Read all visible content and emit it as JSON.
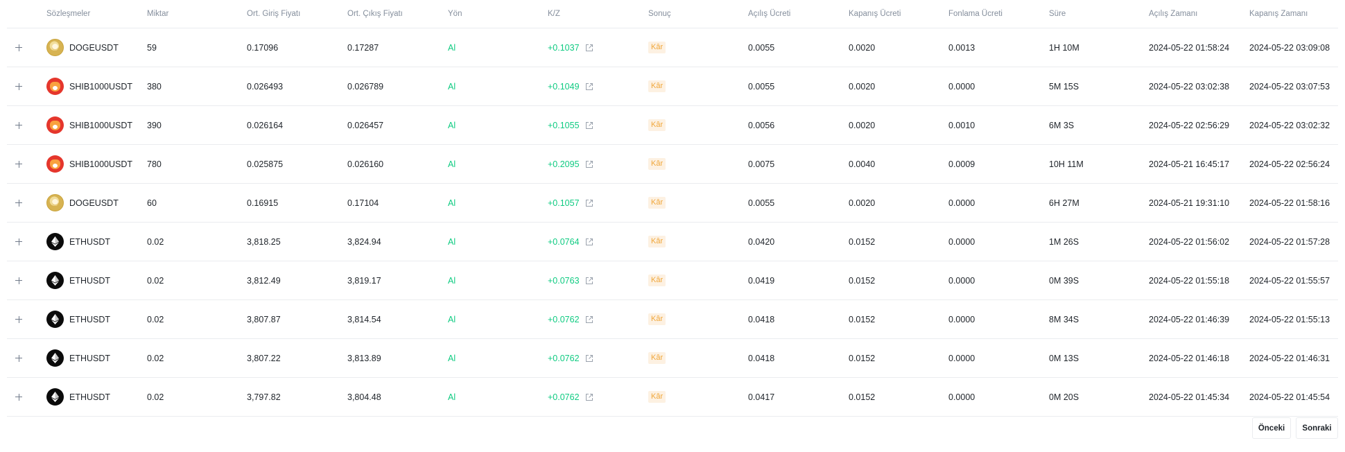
{
  "table": {
    "columns": {
      "contract": "Sözleşmeler",
      "qty": "Miktar",
      "entry": "Ort. Giriş Fiyatı",
      "exit": "Ort. Çıkış Fiyatı",
      "side": "Yön",
      "pnl": "K/Z",
      "result": "Sonuç",
      "openfee": "Açılış Ücreti",
      "closefee": "Kapanış Ücreti",
      "fundfee": "Fonlama Ücreti",
      "duration": "Süre",
      "opentime": "Açılış Zamanı",
      "closetime": "Kapanış Zamanı"
    },
    "rows": [
      {
        "icon": "doge-coin-icon",
        "contract": "DOGEUSDT",
        "qty": "59",
        "entry": "0.17096",
        "exit": "0.17287",
        "side": "Al",
        "pnl": "+0.1037",
        "result": "Kâr",
        "openfee": "0.0055",
        "closefee": "0.0020",
        "fundfee": "0.0013",
        "duration": "1H 10M",
        "opentime": "2024-05-22 01:58:24",
        "closetime": "2024-05-22 03:09:08"
      },
      {
        "icon": "shib-coin-icon",
        "contract": "SHIB1000USDT",
        "qty": "380",
        "entry": "0.026493",
        "exit": "0.026789",
        "side": "Al",
        "pnl": "+0.1049",
        "result": "Kâr",
        "openfee": "0.0055",
        "closefee": "0.0020",
        "fundfee": "0.0000",
        "duration": "5M 15S",
        "opentime": "2024-05-22 03:02:38",
        "closetime": "2024-05-22 03:07:53"
      },
      {
        "icon": "shib-coin-icon",
        "contract": "SHIB1000USDT",
        "qty": "390",
        "entry": "0.026164",
        "exit": "0.026457",
        "side": "Al",
        "pnl": "+0.1055",
        "result": "Kâr",
        "openfee": "0.0056",
        "closefee": "0.0020",
        "fundfee": "0.0010",
        "duration": "6M 3S",
        "opentime": "2024-05-22 02:56:29",
        "closetime": "2024-05-22 03:02:32"
      },
      {
        "icon": "shib-coin-icon",
        "contract": "SHIB1000USDT",
        "qty": "780",
        "entry": "0.025875",
        "exit": "0.026160",
        "side": "Al",
        "pnl": "+0.2095",
        "result": "Kâr",
        "openfee": "0.0075",
        "closefee": "0.0040",
        "fundfee": "0.0009",
        "duration": "10H 11M",
        "opentime": "2024-05-21 16:45:17",
        "closetime": "2024-05-22 02:56:24"
      },
      {
        "icon": "doge-coin-icon",
        "contract": "DOGEUSDT",
        "qty": "60",
        "entry": "0.16915",
        "exit": "0.17104",
        "side": "Al",
        "pnl": "+0.1057",
        "result": "Kâr",
        "openfee": "0.0055",
        "closefee": "0.0020",
        "fundfee": "0.0000",
        "duration": "6H 27M",
        "opentime": "2024-05-21 19:31:10",
        "closetime": "2024-05-22 01:58:16"
      },
      {
        "icon": "eth-coin-icon",
        "contract": "ETHUSDT",
        "qty": "0.02",
        "entry": "3,818.25",
        "exit": "3,824.94",
        "side": "Al",
        "pnl": "+0.0764",
        "result": "Kâr",
        "openfee": "0.0420",
        "closefee": "0.0152",
        "fundfee": "0.0000",
        "duration": "1M 26S",
        "opentime": "2024-05-22 01:56:02",
        "closetime": "2024-05-22 01:57:28"
      },
      {
        "icon": "eth-coin-icon",
        "contract": "ETHUSDT",
        "qty": "0.02",
        "entry": "3,812.49",
        "exit": "3,819.17",
        "side": "Al",
        "pnl": "+0.0763",
        "result": "Kâr",
        "openfee": "0.0419",
        "closefee": "0.0152",
        "fundfee": "0.0000",
        "duration": "0M 39S",
        "opentime": "2024-05-22 01:55:18",
        "closetime": "2024-05-22 01:55:57"
      },
      {
        "icon": "eth-coin-icon",
        "contract": "ETHUSDT",
        "qty": "0.02",
        "entry": "3,807.87",
        "exit": "3,814.54",
        "side": "Al",
        "pnl": "+0.0762",
        "result": "Kâr",
        "openfee": "0.0418",
        "closefee": "0.0152",
        "fundfee": "0.0000",
        "duration": "8M 34S",
        "opentime": "2024-05-22 01:46:39",
        "closetime": "2024-05-22 01:55:13"
      },
      {
        "icon": "eth-coin-icon",
        "contract": "ETHUSDT",
        "qty": "0.02",
        "entry": "3,807.22",
        "exit": "3,813.89",
        "side": "Al",
        "pnl": "+0.0762",
        "result": "Kâr",
        "openfee": "0.0418",
        "closefee": "0.0152",
        "fundfee": "0.0000",
        "duration": "0M 13S",
        "opentime": "2024-05-22 01:46:18",
        "closetime": "2024-05-22 01:46:31"
      },
      {
        "icon": "eth-coin-icon",
        "contract": "ETHUSDT",
        "qty": "0.02",
        "entry": "3,797.82",
        "exit": "3,804.48",
        "side": "Al",
        "pnl": "+0.0762",
        "result": "Kâr",
        "openfee": "0.0417",
        "closefee": "0.0152",
        "fundfee": "0.0000",
        "duration": "0M 20S",
        "opentime": "2024-05-22 01:45:34",
        "closetime": "2024-05-22 01:45:54"
      }
    ]
  },
  "pagination": {
    "prev_label": "Önceki",
    "next_label": "Sonraki"
  },
  "colors": {
    "buy": "#0ecb81",
    "profit_badge_bg": "#fdf1e2",
    "profit_badge_text": "#f0a73b",
    "muted_text": "#848e9c"
  }
}
